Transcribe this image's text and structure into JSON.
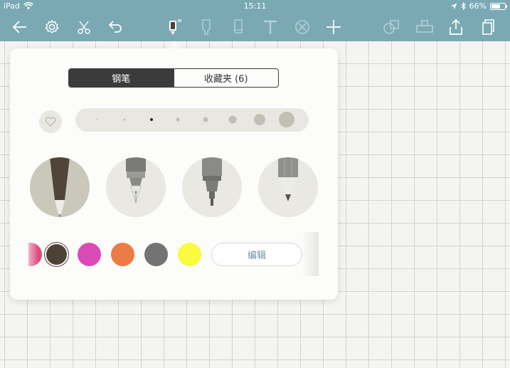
{
  "status_bar": {
    "device": "iPad",
    "time": "15:11",
    "battery": "66%",
    "battery_level": 0.66
  },
  "toolbar": {
    "icons": [
      "back-arrow-icon",
      "gear-icon",
      "scissors-icon",
      "undo-icon",
      "pen-icon",
      "highlighter-icon",
      "marker-icon",
      "text-icon",
      "eraser-icon",
      "plus-icon",
      "shapes-icon",
      "ruler-icon",
      "share-icon",
      "pages-icon"
    ],
    "tint": "#ffffff",
    "inactive_tint": "#b5d0d6",
    "background": "#7aa9b4"
  },
  "popover": {
    "tabs": [
      {
        "label": "钢笔",
        "active": true
      },
      {
        "label": "收藏夹 (6)",
        "active": false
      }
    ],
    "favorite_icon": "heart-icon",
    "sizes": {
      "count": 8,
      "selected_index": 2
    },
    "pens": [
      {
        "name": "ballpoint",
        "selected": true
      },
      {
        "name": "fountain-pen",
        "selected": false
      },
      {
        "name": "fineliner",
        "selected": false
      },
      {
        "name": "pencil",
        "selected": false
      }
    ],
    "colors": [
      {
        "hex": "#e0487c",
        "selected": false
      },
      {
        "hex": "#4e4135",
        "selected": true
      },
      {
        "hex": "#d94ab7",
        "selected": false
      },
      {
        "hex": "#ed7b45",
        "selected": false
      },
      {
        "hex": "#737373",
        "selected": false
      },
      {
        "hex": "#fafa3e",
        "selected": false
      }
    ],
    "edit_label": "编辑"
  }
}
